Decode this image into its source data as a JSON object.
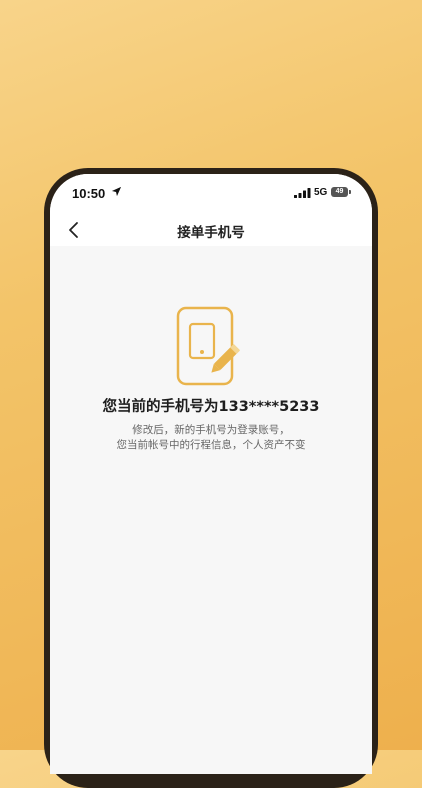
{
  "status": {
    "time": "10:50",
    "network": "5G",
    "battery": "49"
  },
  "nav": {
    "title": "接单手机号"
  },
  "main": {
    "current_phone_text": "您当前的手机号为133****5233",
    "tip_line1": "修改后，新的手机号为登录账号，",
    "tip_line2": "您当前帐号中的行程信息，个人资产不变"
  },
  "colors": {
    "accent": "#e9b44c",
    "background": "#f7f7f7"
  }
}
